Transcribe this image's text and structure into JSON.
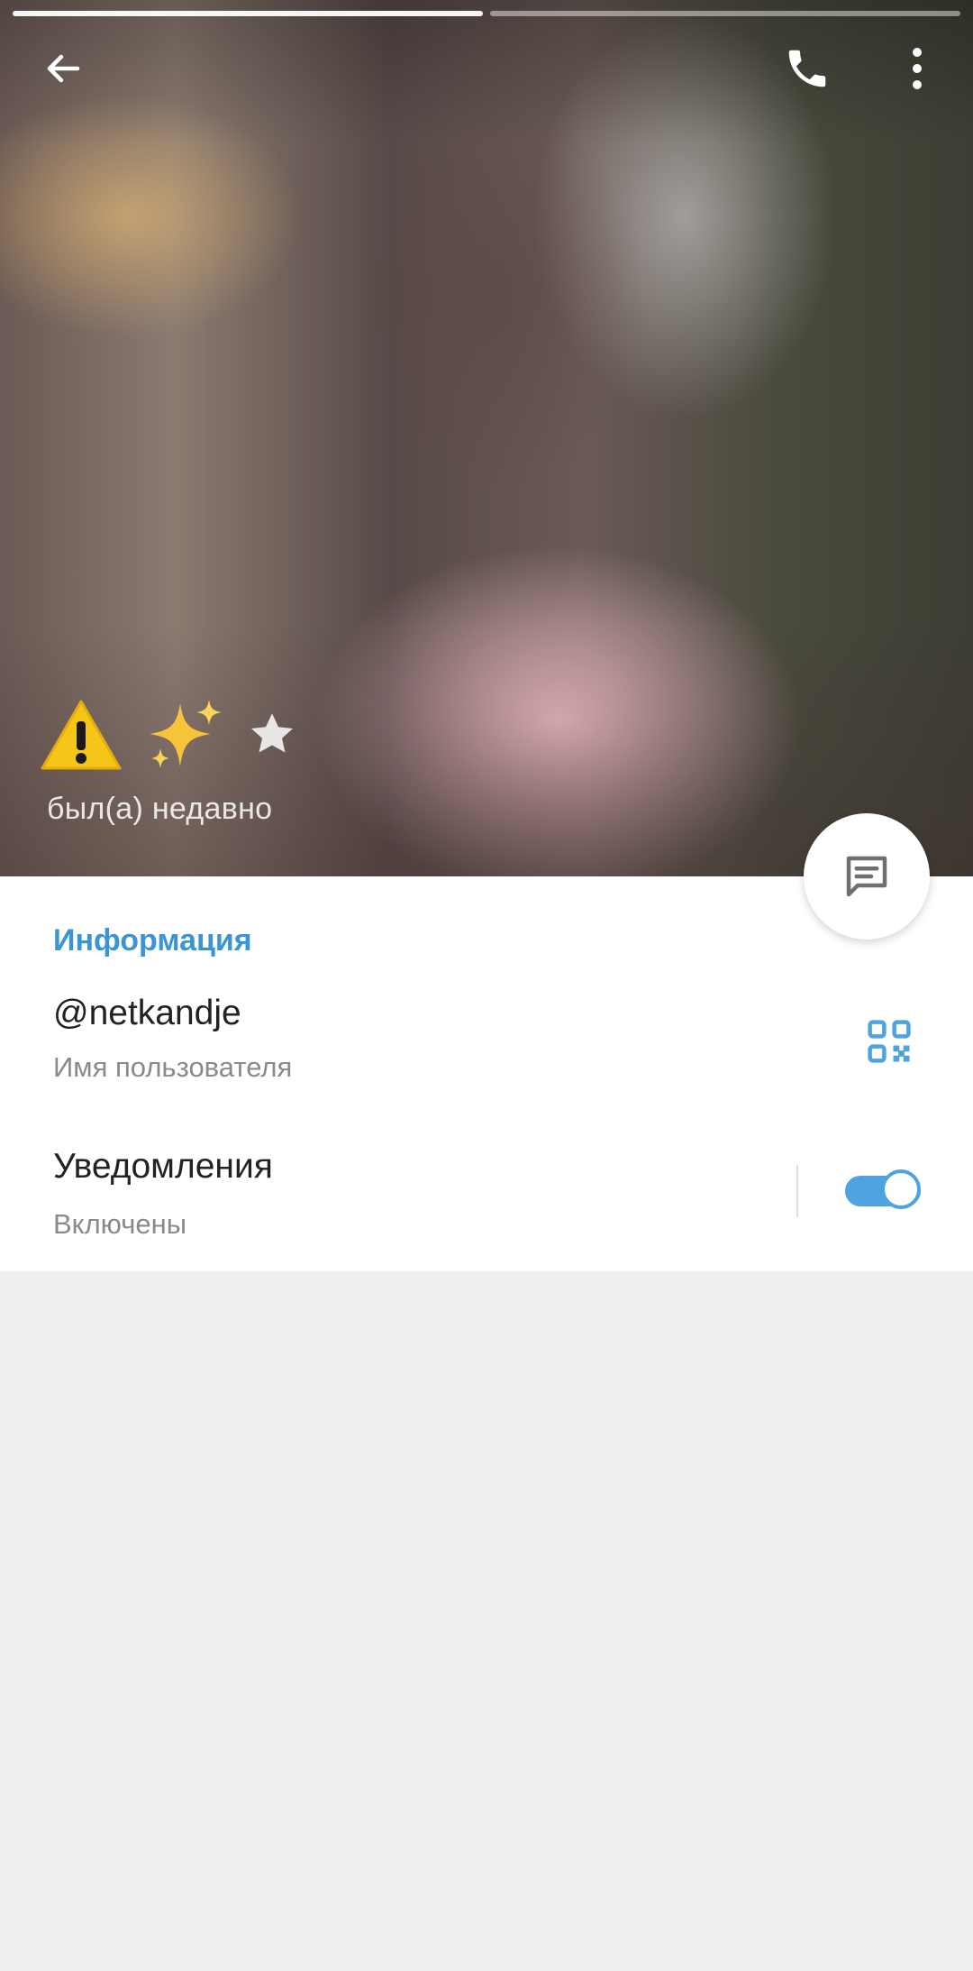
{
  "header": {
    "back_icon": "arrow-left-icon",
    "call_icon": "phone-icon",
    "more_icon": "more-vertical-icon",
    "story_segments": [
      {
        "active": true
      },
      {
        "active": false
      }
    ],
    "emoji_status": [
      "⚠️",
      "✨",
      "star-badge-icon"
    ],
    "last_seen": "был(а) недавно",
    "message_button_icon": "chat-bubble-icon"
  },
  "info": {
    "section_title": "Информация",
    "username": "@netkandje",
    "username_caption": "Имя пользователя",
    "qr_icon": "qr-code-icon",
    "notifications_label": "Уведомления",
    "notifications_status": "Включены",
    "notifications_enabled": true
  },
  "colors": {
    "accent": "#3a95d5",
    "toggle": "#4fa3e0",
    "background": "#efefef"
  }
}
